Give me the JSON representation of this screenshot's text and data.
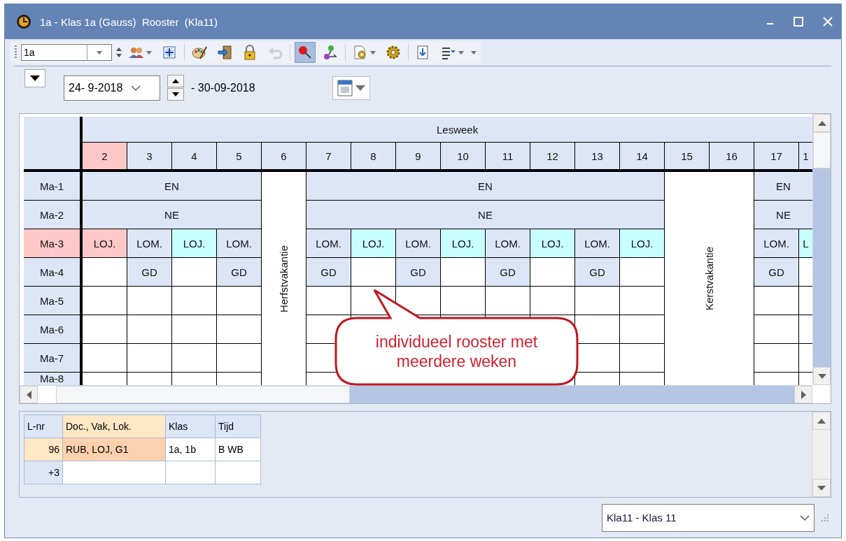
{
  "window": {
    "title": "1a - Klas 1a (Gauss)  Rooster  (Kla11)"
  },
  "toolbar": {
    "class_value": "1a",
    "tools": [
      {
        "selected": false,
        "disabled": false
      },
      {
        "selected": false,
        "disabled": false
      },
      {
        "selected": false,
        "disabled": false
      },
      {
        "selected": false,
        "disabled": false
      },
      {
        "selected": false,
        "disabled": false
      },
      {
        "selected": false,
        "disabled": true
      },
      {
        "selected": true,
        "disabled": false
      },
      {
        "selected": false,
        "disabled": false
      },
      {
        "selected": false,
        "disabled": false
      },
      {
        "selected": false,
        "disabled": false
      },
      {
        "selected": false,
        "disabled": false
      },
      {
        "selected": false,
        "disabled": false
      }
    ]
  },
  "date_bar": {
    "date_from": "24- 9-2018",
    "date_to": "- 30-09-2018"
  },
  "schedule": {
    "header": "Lesweek",
    "hours": [
      {
        "label": "Ma-1",
        "selected": false
      },
      {
        "label": "Ma-2",
        "selected": false
      },
      {
        "label": "Ma-3",
        "selected": true
      },
      {
        "label": "Ma-4",
        "selected": false
      },
      {
        "label": "Ma-5",
        "selected": false
      },
      {
        "label": "Ma-6",
        "selected": false
      },
      {
        "label": "Ma-7",
        "selected": false
      },
      {
        "label": "Ma-8",
        "selected": false
      }
    ],
    "periods": [
      {
        "kind": "lessons",
        "weeks": [
          {
            "label": "2",
            "selected": true
          },
          {
            "label": "3",
            "selected": false
          },
          {
            "label": "4",
            "selected": false
          },
          {
            "label": "5",
            "selected": false
          }
        ],
        "rows": [
          {
            "kind": "merged",
            "text": "EN"
          },
          {
            "kind": "merged",
            "text": "NE"
          },
          {
            "kind": "split",
            "cells": [
              {
                "kind": "lesson",
                "text": "LOJ.",
                "color": "#ffc8c8"
              },
              {
                "kind": "lesson",
                "text": "LOM.",
                "color": "#dce6f6"
              },
              {
                "kind": "lesson",
                "text": "LOJ.",
                "color": "#c8ffff"
              },
              {
                "kind": "lesson",
                "text": "LOM.",
                "color": "#dce6f6"
              }
            ]
          },
          {
            "kind": "split",
            "cells": [
              {
                "kind": "empty"
              },
              {
                "kind": "lesson",
                "text": "GD",
                "color": "#dce6f6"
              },
              {
                "kind": "empty"
              },
              {
                "kind": "lesson",
                "text": "GD",
                "color": "#dce6f6"
              }
            ]
          },
          {
            "kind": "empty"
          },
          {
            "kind": "empty"
          },
          {
            "kind": "empty"
          },
          {
            "kind": "empty"
          }
        ]
      },
      {
        "kind": "holiday",
        "label": "Herfstvakantie",
        "weeks": [
          {
            "label": "6",
            "selected": false
          }
        ]
      },
      {
        "kind": "lessons",
        "weeks": [
          {
            "label": "7",
            "selected": false
          },
          {
            "label": "8",
            "selected": false
          },
          {
            "label": "9",
            "selected": false
          },
          {
            "label": "10",
            "selected": false
          },
          {
            "label": "11",
            "selected": false
          },
          {
            "label": "12",
            "selected": false
          },
          {
            "label": "13",
            "selected": false
          },
          {
            "label": "14",
            "selected": false
          }
        ],
        "rows": [
          {
            "kind": "merged",
            "text": "EN"
          },
          {
            "kind": "merged",
            "text": "NE"
          },
          {
            "kind": "split",
            "cells": [
              {
                "kind": "lesson",
                "text": "LOM.",
                "color": "#dce6f6"
              },
              {
                "kind": "lesson",
                "text": "LOJ.",
                "color": "#c8ffff"
              },
              {
                "kind": "lesson",
                "text": "LOM.",
                "color": "#dce6f6"
              },
              {
                "kind": "lesson",
                "text": "LOJ.",
                "color": "#c8ffff"
              },
              {
                "kind": "lesson",
                "text": "LOM.",
                "color": "#dce6f6"
              },
              {
                "kind": "lesson",
                "text": "LOJ.",
                "color": "#c8ffff"
              },
              {
                "kind": "lesson",
                "text": "LOM.",
                "color": "#dce6f6"
              },
              {
                "kind": "lesson",
                "text": "LOJ.",
                "color": "#c8ffff"
              }
            ]
          },
          {
            "kind": "split",
            "cells": [
              {
                "kind": "lesson",
                "text": "GD",
                "color": "#dce6f6"
              },
              {
                "kind": "empty"
              },
              {
                "kind": "lesson",
                "text": "GD",
                "color": "#dce6f6"
              },
              {
                "kind": "empty"
              },
              {
                "kind": "lesson",
                "text": "GD",
                "color": "#dce6f6"
              },
              {
                "kind": "empty"
              },
              {
                "kind": "lesson",
                "text": "GD",
                "color": "#dce6f6"
              },
              {
                "kind": "empty"
              }
            ]
          },
          {
            "kind": "empty"
          },
          {
            "kind": "empty"
          },
          {
            "kind": "empty"
          },
          {
            "kind": "empty"
          }
        ]
      },
      {
        "kind": "holiday",
        "label": "Kerstvakantie",
        "weeks": [
          {
            "label": "15",
            "selected": false
          },
          {
            "label": "16",
            "selected": false
          }
        ]
      },
      {
        "kind": "lessons",
        "weeks": [
          {
            "label": "17",
            "selected": false
          },
          {
            "label": "1",
            "selected": false
          }
        ],
        "rows": [
          {
            "kind": "merged",
            "text": "EN"
          },
          {
            "kind": "merged",
            "text": "NE"
          },
          {
            "kind": "split",
            "cells": [
              {
                "kind": "lesson",
                "text": "LOM.",
                "color": "#dce6f6"
              },
              {
                "kind": "lesson",
                "text": "L",
                "color": "#c8ffff"
              }
            ]
          },
          {
            "kind": "split",
            "cells": [
              {
                "kind": "lesson",
                "text": "GD",
                "color": "#dce6f6"
              },
              {
                "kind": "empty"
              }
            ]
          },
          {
            "kind": "empty"
          },
          {
            "kind": "empty"
          },
          {
            "kind": "empty"
          },
          {
            "kind": "empty"
          }
        ]
      }
    ]
  },
  "callout": {
    "text": "individueel rooster met meerdere weken"
  },
  "lessons_table": {
    "columns": [
      {
        "label": "L-nr",
        "selected": false
      },
      {
        "label": "Doc., Vak, Lok.",
        "selected": true
      },
      {
        "label": "Klas",
        "selected": false
      },
      {
        "label": "Tijd",
        "selected": false
      }
    ],
    "rows": [
      {
        "selected": true,
        "cells": [
          "96",
          "RUB, LOJ, G1",
          "1a, 1b",
          "B WB"
        ]
      },
      {
        "selected": false,
        "cells": [
          "+3"
        ]
      }
    ]
  },
  "class_select": {
    "value": "Kla11 - Klas 11"
  }
}
